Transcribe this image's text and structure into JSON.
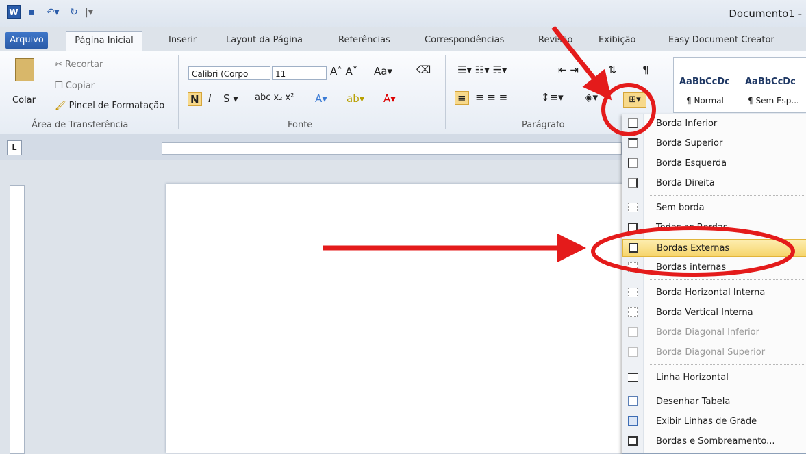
{
  "title": "Documento1 -",
  "tabs": [
    "Arquivo",
    "Página Inicial",
    "Inserir",
    "Layout da Página",
    "Referências",
    "Correspondências",
    "Revisão",
    "Exibição",
    "Easy Document Creator"
  ],
  "clipboard": {
    "paste": "Colar",
    "cut": "Recortar",
    "copy": "Copiar",
    "format_painter": "Pincel de Formatação",
    "group": "Área de Transferência"
  },
  "font": {
    "name": "Calibri (Corpo",
    "size": "11",
    "group": "Fonte"
  },
  "paragraph": {
    "group": "Parágrafo"
  },
  "styles": [
    {
      "preview": "AaBbCcDc",
      "name": "¶ Normal"
    },
    {
      "preview": "AaBbCcDc",
      "name": "¶ Sem Esp..."
    }
  ],
  "border_menu": {
    "items": [
      {
        "label": "Borda Inferior",
        "disabled": false
      },
      {
        "label": "Borda Superior",
        "disabled": false
      },
      {
        "label": "Borda Esquerda",
        "disabled": false
      },
      {
        "label": "Borda Direita",
        "disabled": false
      },
      {
        "label": "Sem borda",
        "disabled": false
      },
      {
        "label": "Todas as Bordas",
        "disabled": false
      },
      {
        "label": "Bordas Externas",
        "disabled": false,
        "highlighted": true
      },
      {
        "label": "Bordas internas",
        "disabled": false
      },
      {
        "label": "Borda Horizontal Interna",
        "disabled": false
      },
      {
        "label": "Borda Vertical Interna",
        "disabled": false
      },
      {
        "label": "Borda Diagonal Inferior",
        "disabled": true
      },
      {
        "label": "Borda Diagonal Superior",
        "disabled": true
      },
      {
        "label": "Linha Horizontal",
        "disabled": false
      },
      {
        "label": "Desenhar Tabela",
        "disabled": false
      },
      {
        "label": "Exibir Linhas de Grade",
        "disabled": false
      },
      {
        "label": "Bordas e Sombreamento...",
        "disabled": false
      }
    ]
  },
  "colors": {
    "annotation": "#e41b1b",
    "highlight": "#f6d56c",
    "accent": "#2a5ba8"
  }
}
